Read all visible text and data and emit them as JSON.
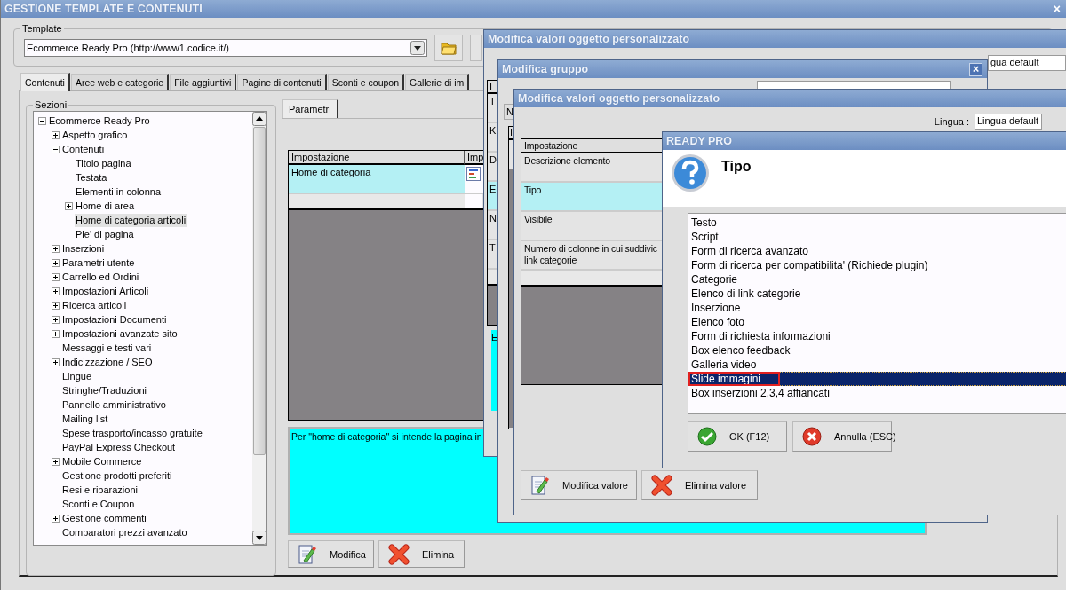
{
  "main_window": {
    "title": "GESTIONE TEMPLATE E CONTENUTI",
    "close": "×",
    "template": {
      "label": "Template",
      "value": "Ecommerce Ready Pro (http://www1.codice.it/)"
    },
    "tabs": [
      {
        "label": "Contenuti",
        "selected": true
      },
      {
        "label": "Aree web e categorie",
        "selected": false
      },
      {
        "label": "File aggiuntivi",
        "selected": false
      },
      {
        "label": "Pagine di contenuti",
        "selected": false
      },
      {
        "label": "Sconti e coupon",
        "selected": false
      },
      {
        "label": "Gallerie di im",
        "selected": false
      }
    ],
    "sections": {
      "label": "Sezioni",
      "tree": [
        {
          "label": "Ecommerce Ready Pro",
          "selected": false,
          "expanded": true,
          "children": [
            {
              "label": "Aspetto grafico",
              "selected": false,
              "expanded": false
            },
            {
              "label": "Contenuti",
              "selected": false,
              "expanded": true,
              "children": [
                {
                  "label": "Titolo pagina",
                  "selected": false
                },
                {
                  "label": "Testata",
                  "selected": false
                },
                {
                  "label": "Elementi in colonna",
                  "selected": false
                },
                {
                  "label": "Home di area",
                  "selected": false,
                  "expanded": false
                },
                {
                  "label": "Home di categoria articoli",
                  "selected": true
                },
                {
                  "label": "Pie' di pagina",
                  "selected": false
                }
              ]
            },
            {
              "label": "Inserzioni",
              "selected": false,
              "expanded": false
            },
            {
              "label": "Parametri utente",
              "selected": false,
              "expanded": false
            },
            {
              "label": "Carrello ed Ordini",
              "selected": false,
              "expanded": false
            },
            {
              "label": "Impostazioni Articoli",
              "selected": false,
              "expanded": false
            },
            {
              "label": "Ricerca articoli",
              "selected": false,
              "expanded": false
            },
            {
              "label": "Impostazioni Documenti",
              "selected": false,
              "expanded": false
            },
            {
              "label": "Impostazioni avanzate sito",
              "selected": false,
              "expanded": false
            },
            {
              "label": "Messaggi e testi vari",
              "selected": false
            },
            {
              "label": "Indicizzazione / SEO",
              "selected": false,
              "expanded": false
            },
            {
              "label": "Lingue",
              "selected": false
            },
            {
              "label": "Stringhe/Traduzioni",
              "selected": false
            },
            {
              "label": "Pannello amministrativo",
              "selected": false
            },
            {
              "label": "Mailing list",
              "selected": false
            },
            {
              "label": "Spese trasporto/incasso gratuite",
              "selected": false
            },
            {
              "label": "PayPal Express Checkout",
              "selected": false
            },
            {
              "label": "Mobile Commerce",
              "selected": false,
              "expanded": false
            },
            {
              "label": "Gestione prodotti preferiti",
              "selected": false
            },
            {
              "label": "Resi e riparazioni",
              "selected": false
            },
            {
              "label": "Sconti e Coupon",
              "selected": false
            },
            {
              "label": "Gestione commenti",
              "selected": false,
              "expanded": false
            },
            {
              "label": "Comparatori prezzi avanzato",
              "selected": false
            }
          ]
        }
      ]
    },
    "parameters": {
      "tab": "Parametri",
      "columns": [
        "Impostazione",
        "Imp"
      ],
      "rows": [
        {
          "setting": "Home di categoria",
          "selected": true
        }
      ],
      "description": "Per \"home di categoria\" si intende la pagina in"
    },
    "buttons": [
      {
        "kind": "edit",
        "label": "Modifica"
      },
      {
        "kind": "delete",
        "label": "Elimina"
      }
    ]
  },
  "window_values_back": {
    "title": "Modifica valori oggetto personalizzato",
    "language_value": "gua default",
    "header": "I",
    "rows": [
      {
        "label": "T",
        "selected": false
      },
      {
        "label": "K",
        "selected": false
      },
      {
        "label": "D",
        "selected": false
      },
      {
        "label": "E",
        "selected": true
      },
      {
        "label": "N",
        "selected": false
      },
      {
        "label": "T",
        "selected": false
      }
    ],
    "description": "E"
  },
  "window_group": {
    "title": "Modifica gruppo",
    "close": "×",
    "field_label": "N",
    "header": "I"
  },
  "window_values": {
    "title": "Modifica valori oggetto personalizzato",
    "language_label": "Lingua :",
    "language_value": "Lingua default",
    "column": "Impostazione",
    "rows": [
      {
        "setting": "Descrizione elemento",
        "selected": false
      },
      {
        "setting": "Tipo",
        "selected": true
      },
      {
        "setting": "Visibile",
        "selected": false
      },
      {
        "setting": "Numero di colonne in cui suddivic\nlink categorie",
        "selected": false
      }
    ],
    "buttons": [
      {
        "kind": "edit",
        "label": "Modifica valore"
      },
      {
        "kind": "delete",
        "label": "Elimina valore"
      }
    ]
  },
  "dialog": {
    "title": "READY PRO",
    "question": "Tipo",
    "options": [
      {
        "label": "Testo",
        "selected": false,
        "circled": false
      },
      {
        "label": "Script",
        "selected": false,
        "circled": false
      },
      {
        "label": "Form di ricerca avanzato",
        "selected": false,
        "circled": false
      },
      {
        "label": "Form di ricerca per compatibilita' (Richiede plugin)",
        "selected": false,
        "circled": false
      },
      {
        "label": "Categorie",
        "selected": false,
        "circled": false
      },
      {
        "label": "Elenco di link categorie",
        "selected": false,
        "circled": false
      },
      {
        "label": "Inserzione",
        "selected": false,
        "circled": false
      },
      {
        "label": "Elenco foto",
        "selected": false,
        "circled": false
      },
      {
        "label": "Form di richiesta informazioni",
        "selected": false,
        "circled": false
      },
      {
        "label": "Box elenco feedback",
        "selected": false,
        "circled": false
      },
      {
        "label": "Galleria video",
        "selected": false,
        "circled": false
      },
      {
        "label": "Slide immagini",
        "selected": true,
        "circled": true
      },
      {
        "label": "Box inserzioni 2,3,4 affiancati",
        "selected": false,
        "circled": false
      }
    ],
    "buttons": [
      {
        "kind": "ok",
        "label": "OK (F12)"
      },
      {
        "kind": "cancel",
        "label": "Annulla (ESC)"
      }
    ]
  }
}
